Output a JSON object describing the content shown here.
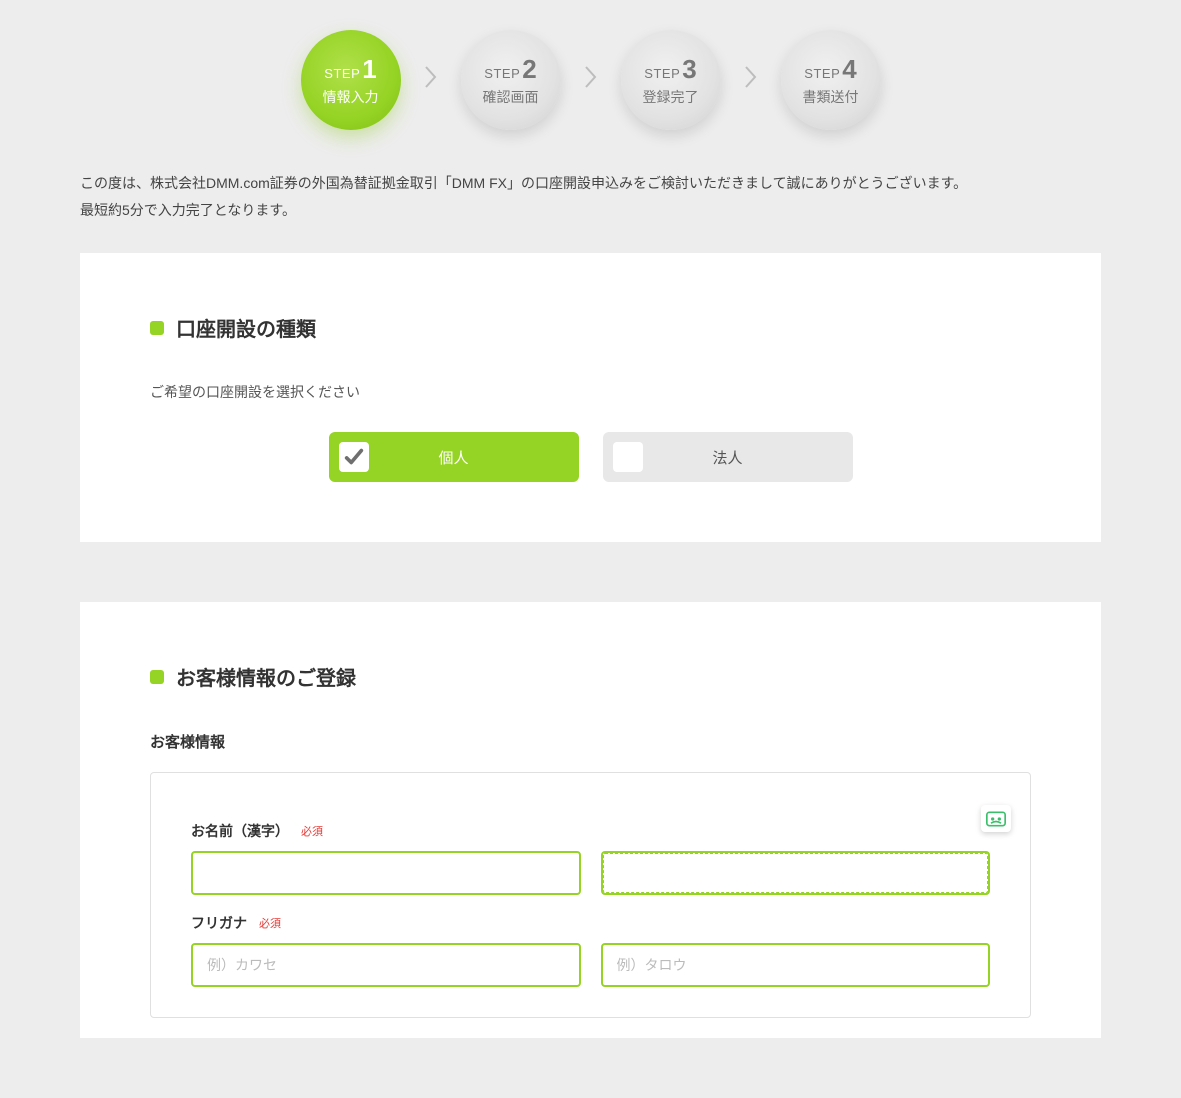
{
  "colors": {
    "accent": "#95d324"
  },
  "steps": {
    "prefix": "STEP",
    "items": [
      {
        "num": "1",
        "label": "情報入力",
        "active": true
      },
      {
        "num": "2",
        "label": "確認画面",
        "active": false
      },
      {
        "num": "3",
        "label": "登録完了",
        "active": false
      },
      {
        "num": "4",
        "label": "書類送付",
        "active": false
      }
    ]
  },
  "intro": {
    "line1": "この度は、株式会社DMM.com証券の外国為替証拠金取引「DMM FX」の口座開設申込みをご検討いただきまして誠にありがとうございます。",
    "line2": "最短約5分で入力完了となります。"
  },
  "section1": {
    "title": "口座開設の種類",
    "prompt": "ご希望の口座開設を選択ください",
    "options": [
      {
        "label": "個人",
        "selected": true
      },
      {
        "label": "法人",
        "selected": false
      }
    ]
  },
  "section2": {
    "title": "お客様情報のご登録",
    "sub_heading": "お客様情報",
    "required_label": "必須",
    "fields": {
      "name_kanji": {
        "label": "お名前（漢字）",
        "value1": "",
        "value2": ""
      },
      "furigana": {
        "label": "フリガナ",
        "placeholder1": "例）カワセ",
        "placeholder2": "例）タロウ"
      }
    }
  }
}
